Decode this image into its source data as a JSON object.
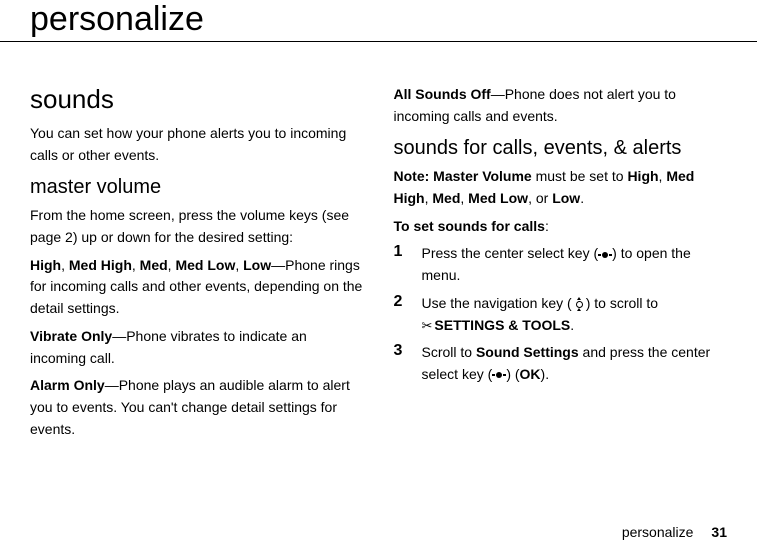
{
  "page_title": "personalize",
  "left": {
    "heading_sounds": "sounds",
    "intro": "You can set how your phone alerts you to incoming calls or other events.",
    "heading_master": "master volume",
    "master_intro": "From the home screen, press the volume keys (see page 2) up or down for the desired setting:",
    "levels": {
      "high": "High",
      "medhigh": "Med High",
      "med": "Med",
      "medlow": "Med Low",
      "low": "Low"
    },
    "levels_desc": "—Phone rings for incoming calls and other events, depending on the detail settings.",
    "vibrate_label": "Vibrate Only",
    "vibrate_desc": "—Phone vibrates to indicate an incoming call.",
    "alarm_label": "Alarm Only",
    "alarm_desc": "—Phone plays an audible alarm to alert you to events. You can't change detail settings for events."
  },
  "right": {
    "allsoundsoff_label": "All Sounds Off",
    "allsoundsoff_desc": "—Phone does not alert you to incoming calls and events.",
    "heading_sfc": "sounds for calls, events, & alerts",
    "note_prefix": "Note: ",
    "note_mv": "Master Volume",
    "note_mid": " must be set to ",
    "note_or": ", or ",
    "note_end": ".",
    "toset": "To set sounds for calls",
    "step1_a": "Press the center select key (",
    "step1_b": ") to open the menu.",
    "step2_a": "Use the navigation key (",
    "step2_b": ") to scroll to ",
    "settings_tools": "SETTINGS & TOOLS",
    "step3_a": "Scroll to ",
    "sound_settings": "Sound Settings",
    "step3_b": " and press the center select key (",
    "step3_c": ") (",
    "ok": "OK",
    "step3_d": ")."
  },
  "footer": {
    "label": "personalize",
    "page": "31"
  }
}
